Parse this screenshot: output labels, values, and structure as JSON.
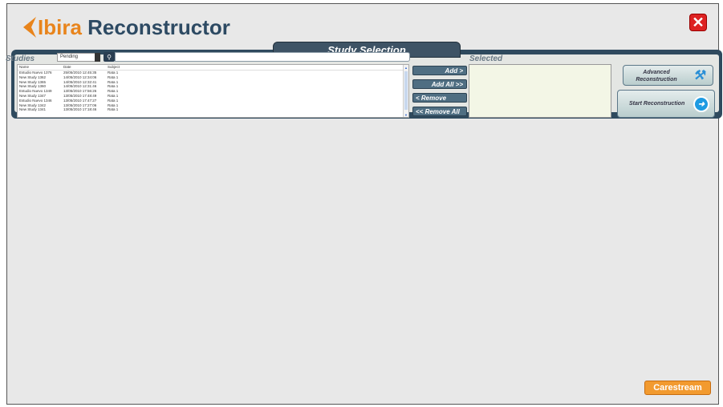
{
  "app": {
    "logo_letter_accent": "Ibira",
    "logo_rest": " Reconstructor",
    "close_symbol": "✕"
  },
  "panel": {
    "title": "Study Selection",
    "studies_label": "Studies",
    "filter_value": "Pending",
    "selected_label": "Selected"
  },
  "table": {
    "columns": [
      "Name",
      "Date",
      "Subject"
    ],
    "rows": [
      [
        "Estudio Nuevo 1376",
        "25/05/2010 12:45:35",
        "Rata 1"
      ],
      [
        "New Study 1362",
        "14/05/2010 12:34:06",
        "Rata 1"
      ],
      [
        "New Study 1365",
        "14/05/2010 12:32:41",
        "Rata 1"
      ],
      [
        "New Study 1360",
        "14/05/2010 12:31:46",
        "Rata 1"
      ],
      [
        "Estudio Nuevo 1349",
        "13/05/2010 17:56:26",
        "Rata 1"
      ],
      [
        "New Study 1347",
        "13/05/2010 17:48:49",
        "Rata 1"
      ],
      [
        "Estudio Nuevo 1346",
        "13/05/2010 17:47:27",
        "Rata 1"
      ],
      [
        "New Study 1342",
        "13/05/2010 17:27:06",
        "Rata 1"
      ],
      [
        "New Study 1341",
        "13/05/2010 17:18:46",
        "Rata 1"
      ]
    ]
  },
  "buttons": {
    "add": "Add >",
    "add_all": "Add All >>",
    "remove": "< Remove",
    "remove_all": "<< Remove All",
    "advanced": "Advanced Reconstruction",
    "start": "Start Reconstruction"
  },
  "brand": {
    "footer": "Carestream",
    "accent_color": "#e8841c",
    "panel_color": "#2f4a5e"
  }
}
